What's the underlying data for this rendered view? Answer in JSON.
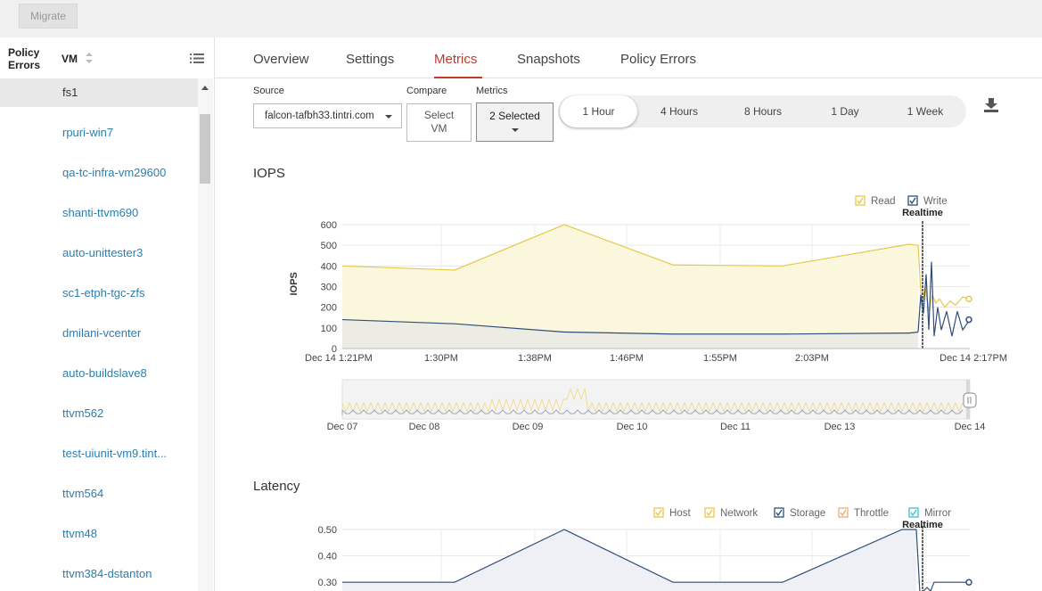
{
  "toolbar": {
    "migrate_label": "Migrate"
  },
  "sidebar": {
    "col_policy_line1": "Policy",
    "col_policy_line2": "Errors",
    "col_vm": "VM",
    "items": [
      {
        "label": "fs1",
        "selected": true
      },
      {
        "label": "rpuri-win7"
      },
      {
        "label": "qa-tc-infra-vm29600"
      },
      {
        "label": "shanti-ttvm690"
      },
      {
        "label": "auto-unittester3"
      },
      {
        "label": "sc1-etph-tgc-zfs"
      },
      {
        "label": "dmilani-vcenter"
      },
      {
        "label": "auto-buildslave8"
      },
      {
        "label": "ttvm562"
      },
      {
        "label": "test-uiunit-vm9.tint..."
      },
      {
        "label": "ttvm564"
      },
      {
        "label": "ttvm48"
      },
      {
        "label": "ttvm384-dstanton"
      }
    ]
  },
  "tabs": [
    {
      "label": "Overview"
    },
    {
      "label": "Settings"
    },
    {
      "label": "Metrics",
      "active": true
    },
    {
      "label": "Snapshots"
    },
    {
      "label": "Policy Errors"
    }
  ],
  "controls": {
    "source_label": "Source",
    "source_value": "falcon-tafbh33.tintri.com",
    "compare_label": "Compare",
    "compare_line1": "Select",
    "compare_line2": "VM",
    "metrics_label": "Metrics",
    "metrics_value": "2 Selected",
    "ranges": [
      {
        "label": "1 Hour",
        "active": true
      },
      {
        "label": "4 Hours"
      },
      {
        "label": "8 Hours"
      },
      {
        "label": "1 Day"
      },
      {
        "label": "1 Week"
      }
    ]
  },
  "colors": {
    "accent": "#c0392b",
    "read": "#e6c84a",
    "write": "#2f4f7a",
    "link": "#2a7fb0",
    "network": "#e6c84a",
    "storage": "#2f4f7a",
    "throttle": "#e8b07a",
    "mirror": "#3fbfd0"
  },
  "chart_data": [
    {
      "type": "area",
      "title": "IOPS",
      "ylabel": "IOPS",
      "ylim": [
        0,
        600
      ],
      "yticks": [
        "600",
        "500",
        "400",
        "300",
        "200",
        "100",
        "0"
      ],
      "xticks": [
        "Dec 14 1:21PM",
        "1:30PM",
        "1:38PM",
        "1:46PM",
        "1:55PM",
        "2:03PM",
        "Dec 14 2:17PM"
      ],
      "realtime_label": "Realtime",
      "legend": [
        "Read",
        "Write"
      ],
      "series": [
        {
          "name": "Read",
          "x": [
            "1:21PM",
            "1:30PM",
            "1:38PM",
            "1:46PM",
            "1:55PM",
            "2:03PM",
            "2:12PM"
          ],
          "values": [
            400,
            380,
            630,
            405,
            400,
            505,
            500
          ]
        },
        {
          "name": "Write",
          "x": [
            "1:21PM",
            "1:30PM",
            "1:38PM",
            "1:46PM",
            "1:55PM",
            "2:03PM",
            "2:12PM"
          ],
          "values": [
            140,
            120,
            80,
            70,
            70,
            75,
            80
          ]
        }
      ],
      "overview_xticks": [
        "Dec 07",
        "Dec 08",
        "Dec 09",
        "Dec 10",
        "Dec 11",
        "Dec 13",
        "Dec 14"
      ]
    },
    {
      "type": "area",
      "title": "Latency",
      "yticks": [
        "0.50",
        "0.40",
        "0.30"
      ],
      "realtime_label": "Realtime",
      "legend": [
        "Host",
        "Network",
        "Storage",
        "Throttle",
        "Mirror"
      ],
      "series": [
        {
          "name": "Storage",
          "x": [
            "1:21PM",
            "1:30PM",
            "1:38PM",
            "1:46PM",
            "1:55PM",
            "2:03PM",
            "2:12PM"
          ],
          "values": [
            0.3,
            0.3,
            0.5,
            0.3,
            0.3,
            0.5,
            0.5
          ]
        }
      ]
    }
  ]
}
